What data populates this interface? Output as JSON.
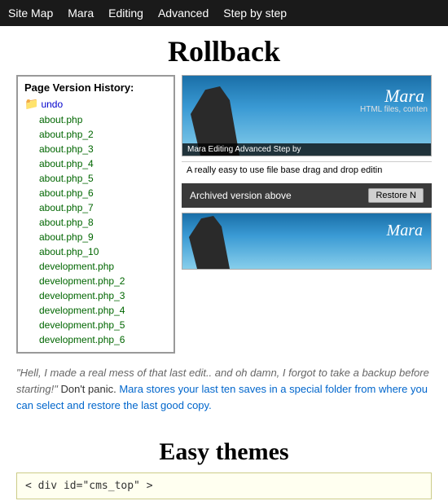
{
  "nav": {
    "items": [
      {
        "label": "Site Map"
      },
      {
        "label": "Mara"
      },
      {
        "label": "Editing"
      },
      {
        "label": "Advanced"
      },
      {
        "label": "Step by step"
      }
    ]
  },
  "rollback": {
    "title": "Rollback",
    "panel_header": "Page Version History:",
    "undo_label": "undo",
    "files": [
      "about.php",
      "about.php_2",
      "about.php_3",
      "about.php_4",
      "about.php_5",
      "about.php_6",
      "about.php_7",
      "about.php_8",
      "about.php_9",
      "about.php_10",
      "development.php",
      "development.php_2",
      "development.php_3",
      "development.php_4",
      "development.php_5",
      "development.php_6"
    ],
    "mara_logo": "Mara",
    "mara_sub": "HTML files, conten",
    "inner_nav": "Mara   Editing   Advanced   Step by",
    "inner_content": "A really easy to use file base drag and drop editin",
    "archived_label": "Archived version above",
    "restore_label": "Restore N",
    "mara_logo_b": "Mara"
  },
  "description": {
    "quote": "\"Hell, I made a real mess of  that last edit.. and oh damn, I forgot to take a backup before starting!\"",
    "text1": " Don't panic.",
    "text2": " Mara stores your last ten saves in a special folder from where you can select and restore the last good copy."
  },
  "easy_themes": {
    "title": "Easy themes",
    "code": "< div id=\"cms_top\" >"
  }
}
